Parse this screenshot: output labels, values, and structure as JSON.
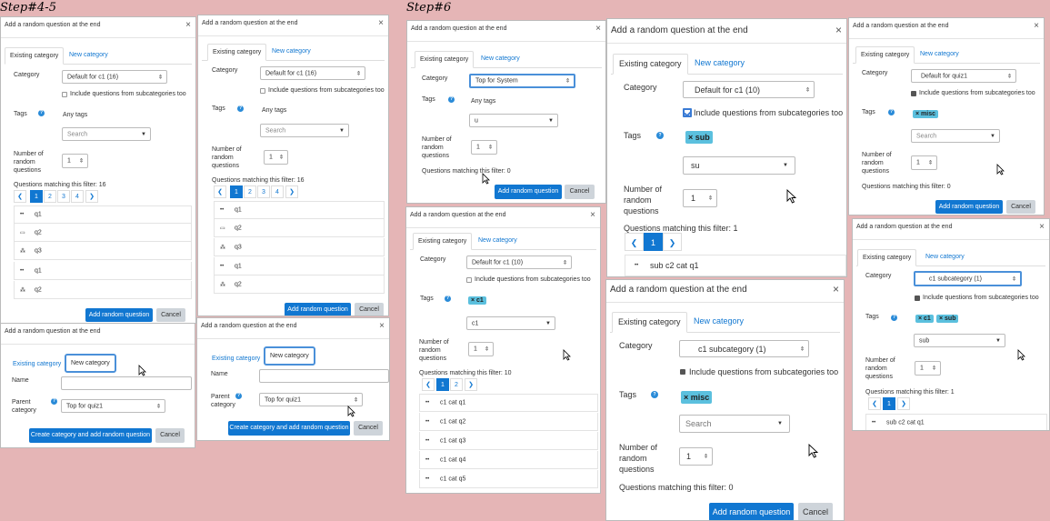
{
  "steps": {
    "a": "Step#4-5",
    "b": "Step#6"
  },
  "dialog_title": "Add a random question at the end",
  "close": "×",
  "tabs": {
    "existing": "Existing category",
    "new": "New category"
  },
  "labels": {
    "category": "Category",
    "tags": "Tags",
    "number1": "Number of",
    "number2": "random",
    "number3": "questions",
    "include": "Include questions from subcategories too",
    "any_tags": "Any tags",
    "search": "Search",
    "name": "Name",
    "parent1": "Parent",
    "parent2": "category",
    "add": "Add random question",
    "cancel": "Cancel",
    "create": "Create category and add random question",
    "matching_prefix": "Questions matching this filter:"
  },
  "icons": {
    "help": "?",
    "caret": "▼",
    "updown": "⇕",
    "prev": "❮",
    "next": "❯"
  },
  "values": {
    "default_c1_16": "Default for c1 (16)",
    "default_c1_10": "Default for c1 (10)",
    "default_quiz1": "Default for quiz1",
    "top_system": "Top for System",
    "top_quiz1": "Top for quiz1",
    "c1_sub": "c1 subcategory (1)",
    "one": "1",
    "u": "u",
    "c1": "c1",
    "su": "su",
    "sub": "sub",
    "m16": "Questions matching this filter: 16",
    "m0": "Questions matching this filter: 0",
    "m10": "Questions matching this filter: 10",
    "m1": "Questions matching this filter: 1"
  },
  "badges": {
    "c1": "× c1",
    "sub": "× sub",
    "misc": "× misc"
  },
  "pages": [
    "1",
    "2",
    "3",
    "4"
  ],
  "q_a": [
    {
      "icon": "••",
      "name": "q1"
    },
    {
      "icon": "▭",
      "name": "q2"
    },
    {
      "icon": "⁂",
      "name": "q3"
    },
    {
      "icon": "••",
      "name": "q1"
    },
    {
      "icon": "⁂",
      "name": "q2"
    }
  ],
  "q_b": [
    {
      "icon": "••",
      "name": "q1"
    },
    {
      "icon": "▭",
      "name": "q2"
    },
    {
      "icon": "⁂",
      "name": "q3"
    },
    {
      "icon": "••",
      "name": "q1"
    },
    {
      "icon": "⁂",
      "name": "q2"
    }
  ],
  "q_c1": [
    {
      "icon": "••",
      "name": "c1 cat q1"
    },
    {
      "icon": "••",
      "name": "c1 cat q2"
    },
    {
      "icon": "••",
      "name": "c1 cat q3"
    },
    {
      "icon": "••",
      "name": "c1 cat q4"
    },
    {
      "icon": "••",
      "name": "c1 cat q5"
    }
  ],
  "q_sub": [
    {
      "icon": "••",
      "name": "sub c2 cat q1"
    }
  ]
}
